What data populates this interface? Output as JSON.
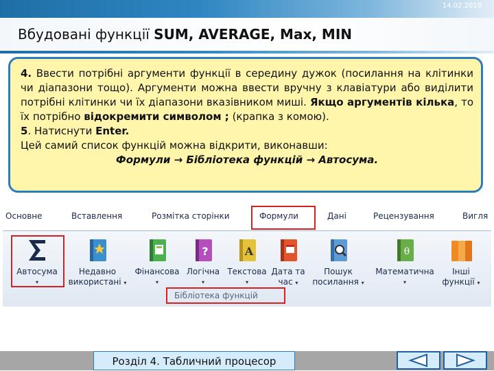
{
  "slide": {
    "date": "14.02.2019",
    "title_prefix": "Вбудовані функції ",
    "title_bold": "SUM, AVERAGE, Max, MIN"
  },
  "textbox": {
    "p1_num": "4.",
    "p1_text": " Ввести потрібні аргументи функції в середину дужок (посилання на клітинки чи діапазони тощо). Аргументи можна ввести вручну з клавіатури або виділити потрібні клітинки чи їх діапазони вказівником миші. ",
    "p1_bold": "Якщо аргументів кілька",
    "p1_mid": ", то їх потрібно ",
    "p1_bold2": "відокремити символом ;",
    "p1_end": " (крапка з комою).",
    "p2_num": "5",
    "p2_text": ". Натиснути ",
    "p2_bold": "Enter.",
    "p3_text": "Цей самий список функцій можна відкрити, виконавши:",
    "p4_path": "Формули → Бібліотека функцій → Автосума."
  },
  "ribbon": {
    "tabs": [
      "Основне",
      "Вставлення",
      "Розмітка сторінки",
      "Формули",
      "Дані",
      "Рецензування",
      "Вигля"
    ],
    "buttons": [
      {
        "line1": "Автосума",
        "line2": "",
        "icon": "sigma-icon"
      },
      {
        "line1": "Недавно",
        "line2": "використані",
        "icon": "star-book-icon"
      },
      {
        "line1": "Фінансова",
        "line2": "",
        "icon": "finance-book-icon"
      },
      {
        "line1": "Логічна",
        "line2": "",
        "icon": "question-book-icon"
      },
      {
        "line1": "Текстова",
        "line2": "",
        "icon": "text-book-icon"
      },
      {
        "line1": "Дата та",
        "line2": "час",
        "icon": "calendar-book-icon"
      },
      {
        "line1": "Пошук",
        "line2": "посилання",
        "icon": "search-book-icon"
      },
      {
        "line1": "Математична",
        "line2": "",
        "icon": "theta-book-icon"
      },
      {
        "line1": "Інші",
        "line2": "функції",
        "icon": "books-icon"
      }
    ],
    "group_label": "Бібліотека функцій",
    "dropdown_arrow": "▾"
  },
  "footer": {
    "section_label": "Розділ 4. Табличний процесор"
  },
  "colors": {
    "accent": "#2c7bbf",
    "highlight_border": "#d42020",
    "textbox_bg": "#fff6ac"
  }
}
